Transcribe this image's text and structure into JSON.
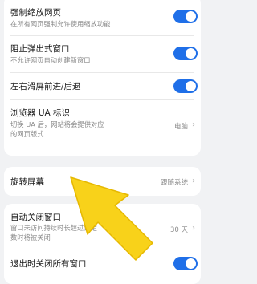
{
  "settings": {
    "force_zoom": {
      "title": "强制缩放网页",
      "subtitle": "在所有网页强制允许使用缩放功能",
      "enabled": true
    },
    "block_popups": {
      "title": "阻止弹出式窗口",
      "subtitle": "不允许网页自动创建新窗口",
      "enabled": true
    },
    "swipe_nav": {
      "title": "左右滑屏前进/后退",
      "enabled": true
    },
    "ua": {
      "title": "浏览器 UA 标识",
      "subtitle_line1": "切换 UA 后，网站将会提供对应",
      "subtitle_line2": "的网页版式",
      "value": "电脑"
    },
    "rotate": {
      "title": "旋转屏幕",
      "value": "跟随系统"
    },
    "auto_close": {
      "title": "自动关闭窗口",
      "subtitle_line1": "窗口未访问持续时长超过设定",
      "subtitle_line2": "数时将被关闭",
      "value": "30 天"
    },
    "close_all_on_exit": {
      "title": "退出时关闭所有窗口",
      "enabled": true
    }
  }
}
